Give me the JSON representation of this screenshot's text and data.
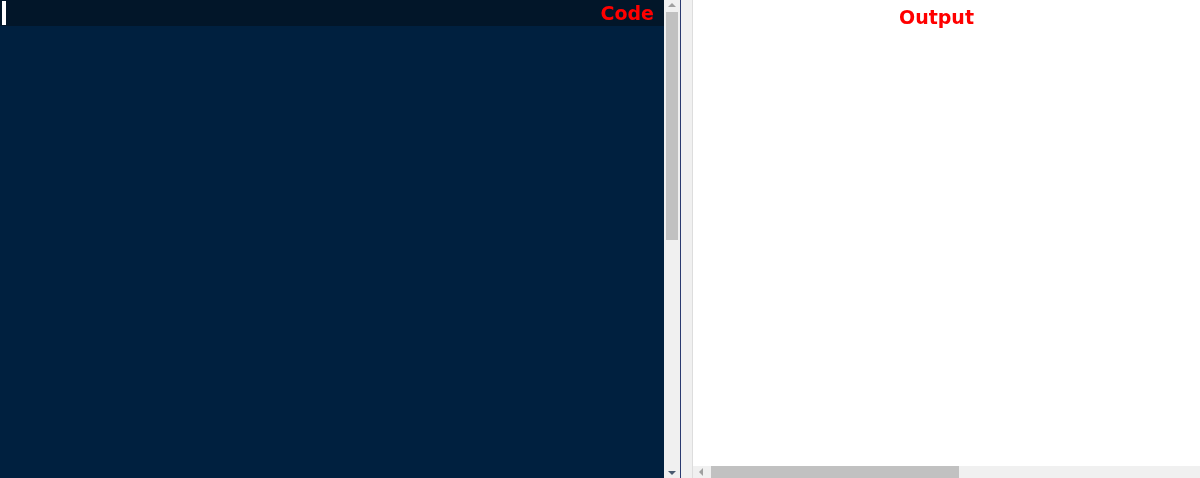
{
  "code_panel": {
    "label": "Code"
  },
  "output_panel": {
    "label": "Output"
  }
}
